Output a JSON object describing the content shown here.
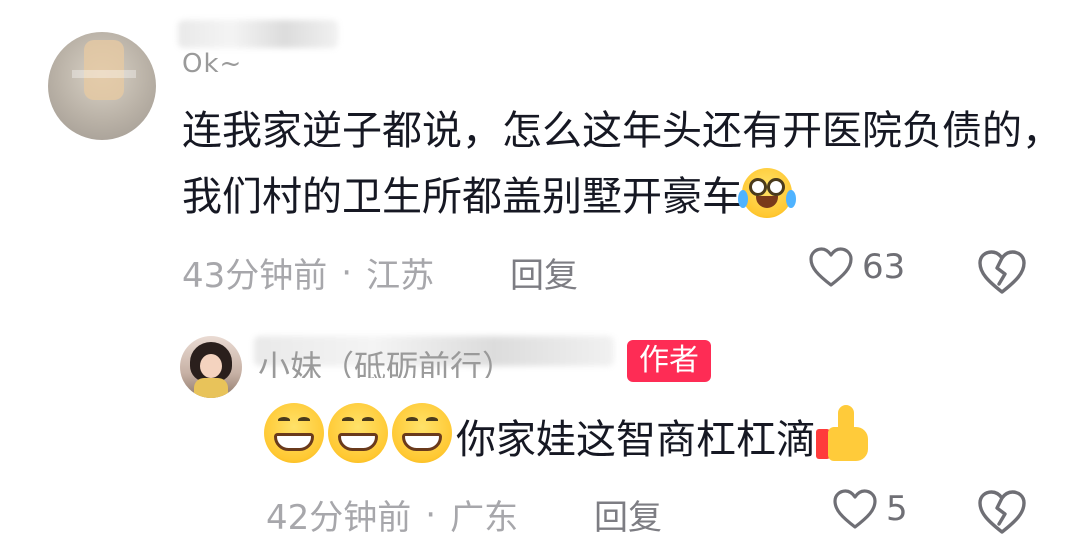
{
  "comments": [
    {
      "nickname_visible": "Ok~",
      "text": "连我家逆子都说，怎么这年头还有开医院负债的，我们村的卫生所都盖别墅开豪车",
      "emoji": "loudly-crying-face",
      "time": "43分钟前",
      "separator": "·",
      "location": "江苏",
      "reply_label": "回复",
      "likes": "63"
    },
    {
      "nickname_visible": "小妹（砥砺前行）",
      "badge": "作者",
      "emoji_prefix": [
        "grinning-face",
        "grinning-face",
        "grinning-face"
      ],
      "text": "你家娃这智商杠杠滴",
      "emoji_suffix": "thumbs-up",
      "time": "42分钟前",
      "separator": "·",
      "location": "广东",
      "reply_label": "回复",
      "likes": "5"
    }
  ],
  "colors": {
    "badge_bg": "#fe2c55",
    "meta_text": "#a7a7ab",
    "body_text": "#161823"
  }
}
